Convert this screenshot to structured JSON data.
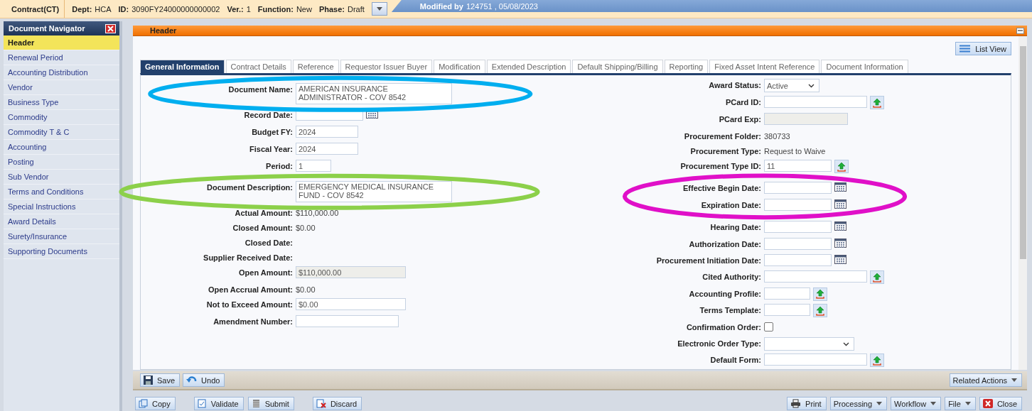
{
  "top_bar": {
    "document_type": "Contract(CT)",
    "fields": [
      {
        "label": "Dept:",
        "value": "HCA"
      },
      {
        "label": "ID:",
        "value": "3090FY24000000000002"
      },
      {
        "label": "Ver.:",
        "value": "1"
      },
      {
        "label": "Function:",
        "value": "New"
      },
      {
        "label": "Phase:",
        "value": "Draft"
      }
    ],
    "modified": {
      "label": "Modified by",
      "value": "124751 , 05/08/2023"
    }
  },
  "navigator": {
    "title": "Document Navigator",
    "items": [
      {
        "label": "Header",
        "selected": true
      },
      {
        "label": "Renewal Period",
        "selected": false
      },
      {
        "label": "Accounting Distribution",
        "selected": false
      },
      {
        "label": "Vendor",
        "selected": false
      },
      {
        "label": "Business Type",
        "selected": false
      },
      {
        "label": "Commodity",
        "selected": false
      },
      {
        "label": "Commodity T & C",
        "selected": false
      },
      {
        "label": "Accounting",
        "selected": false
      },
      {
        "label": "Posting",
        "selected": false
      },
      {
        "label": "Sub Vendor",
        "selected": false
      },
      {
        "label": "Terms and Conditions",
        "selected": false
      },
      {
        "label": "Special Instructions",
        "selected": false
      },
      {
        "label": "Award Details",
        "selected": false
      },
      {
        "label": "Surety/Insurance",
        "selected": false
      },
      {
        "label": "Supporting Documents",
        "selected": false
      }
    ]
  },
  "panel": {
    "title": "Header",
    "list_view_button": "List View"
  },
  "tabs": [
    {
      "label": "General Information",
      "selected": true
    },
    {
      "label": "Contract Details",
      "selected": false
    },
    {
      "label": "Reference",
      "selected": false
    },
    {
      "label": "Requestor Issuer Buyer",
      "selected": false
    },
    {
      "label": "Modification",
      "selected": false
    },
    {
      "label": "Extended Description",
      "selected": false
    },
    {
      "label": "Default Shipping/Billing",
      "selected": false
    },
    {
      "label": "Reporting",
      "selected": false
    },
    {
      "label": "Fixed Asset Intent Reference",
      "selected": false
    },
    {
      "label": "Document Information",
      "selected": false
    }
  ],
  "form": {
    "left": [
      {
        "label": "Document Name:",
        "kind": "textarea",
        "value": "AMERICAN INSURANCE ADMINISTRATOR - COV 8542"
      },
      {
        "label": "Record Date:",
        "kind": "date"
      },
      {
        "label": "Budget FY:",
        "kind": "text",
        "value": "2024"
      },
      {
        "label": "Fiscal Year:",
        "kind": "text",
        "value": "2024"
      },
      {
        "label": "Period:",
        "kind": "text",
        "value": "1"
      },
      {
        "label": "Document Description:",
        "kind": "textarea",
        "value": "EMERGENCY MEDICAL INSURANCE FUND  - COV 8542"
      },
      {
        "label": "Actual Amount:",
        "kind": "value",
        "value": "$110,000.00"
      },
      {
        "label": "Closed Amount:",
        "kind": "value",
        "value": "$0.00"
      },
      {
        "label": "Closed Date:",
        "kind": "value"
      },
      {
        "label": "Supplier Received Date:",
        "kind": "value"
      },
      {
        "label": "Open Amount:",
        "kind": "readonly",
        "value": "$110,000.00"
      },
      {
        "label": "Open Accrual Amount:",
        "kind": "value",
        "value": "$0.00"
      },
      {
        "label": "Not to Exceed Amount:",
        "kind": "text",
        "value": "$0.00"
      },
      {
        "label": "Amendment Number:",
        "kind": "text"
      }
    ],
    "right": [
      {
        "label": "Award Status:",
        "kind": "select",
        "value": "Active"
      },
      {
        "label": "PCard ID:",
        "kind": "lookup"
      },
      {
        "label": "PCard Exp:",
        "kind": "readonly"
      },
      {
        "label": "Procurement Folder:",
        "kind": "value",
        "value": "380733"
      },
      {
        "label": "Procurement Type:",
        "kind": "value",
        "value": "Request to Waive"
      },
      {
        "label": "Procurement Type ID:",
        "kind": "lookup",
        "value": "11"
      },
      {
        "label": "Effective Begin Date:",
        "kind": "date"
      },
      {
        "label": "Expiration Date:",
        "kind": "date"
      },
      {
        "label": "Hearing Date:",
        "kind": "date"
      },
      {
        "label": "Authorization Date:",
        "kind": "date"
      },
      {
        "label": "Procurement Initiation Date:",
        "kind": "date"
      },
      {
        "label": "Cited Authority:",
        "kind": "lookup"
      },
      {
        "label": "Accounting Profile:",
        "kind": "lookup"
      },
      {
        "label": "Terms Template:",
        "kind": "lookup"
      },
      {
        "label": "Confirmation Order:",
        "kind": "checkbox",
        "checked": false
      },
      {
        "label": "Electronic Order Type:",
        "kind": "select"
      },
      {
        "label": "Default Form:",
        "kind": "lookup"
      }
    ]
  },
  "toolbar": {
    "left": [
      {
        "label": "Save",
        "kind": "plain"
      },
      {
        "label": "Undo",
        "kind": "plain"
      }
    ],
    "right": [
      {
        "label": "Related Actions",
        "kind": "menu"
      }
    ]
  },
  "actions": {
    "left": [
      {
        "label": "Copy",
        "kind": "plain"
      },
      {
        "label": "Validate",
        "kind": "plain"
      },
      {
        "label": "Submit",
        "kind": "plain"
      },
      {
        "label": "Discard",
        "kind": "plain"
      }
    ],
    "right": [
      {
        "label": "Print",
        "kind": "plain"
      },
      {
        "label": "Processing",
        "kind": "menu"
      },
      {
        "label": "Workflow",
        "kind": "menu"
      },
      {
        "label": "File",
        "kind": "menu"
      },
      {
        "label": "Close",
        "kind": "plain"
      }
    ]
  },
  "annotations": [
    {
      "color": "#00aeef"
    },
    {
      "color": "#8cd04a"
    },
    {
      "color": "#e010c8"
    }
  ]
}
